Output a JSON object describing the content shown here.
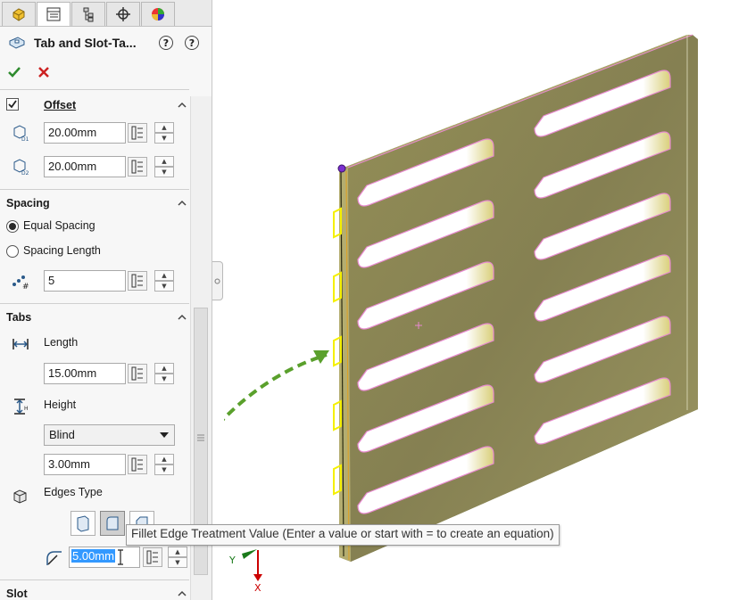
{
  "feature": {
    "title": "Tab and Slot-Ta...",
    "help_labels": [
      "?",
      "?"
    ]
  },
  "sections": {
    "offset": {
      "title": "Offset",
      "checked": true,
      "d1_value": "20.00mm",
      "d2_value": "20.00mm"
    },
    "spacing": {
      "title": "Spacing",
      "equal_label": "Equal Spacing",
      "length_label": "Spacing Length",
      "selected": "equal",
      "count_value": "5"
    },
    "tabs": {
      "title": "Tabs",
      "length_label": "Length",
      "length_value": "15.00mm",
      "height_label": "Height",
      "height_type": "Blind",
      "height_value": "3.00mm",
      "edges_label": "Edges Type",
      "fillet_value": "5.00mm"
    },
    "slot": {
      "title": "Slot"
    }
  },
  "tooltip": {
    "text": "Fillet Edge Treatment Value (Enter a value or start with = to create an equation)"
  },
  "triad": {
    "y_label": "Y",
    "x_label": "X"
  },
  "colors": {
    "plate": "#8f8a52",
    "slot_highlight": "#e88ad0",
    "tab_highlight": "#f5f000",
    "arrow": "#5aa02c",
    "accept": "#2e8b2e",
    "cancel": "#cc2222"
  },
  "icons": [
    "part-icon",
    "property-manager-icon",
    "configuration-icon",
    "target-icon",
    "appearance-icon",
    "tab-slot-feature-icon",
    "accept-icon",
    "cancel-icon"
  ]
}
